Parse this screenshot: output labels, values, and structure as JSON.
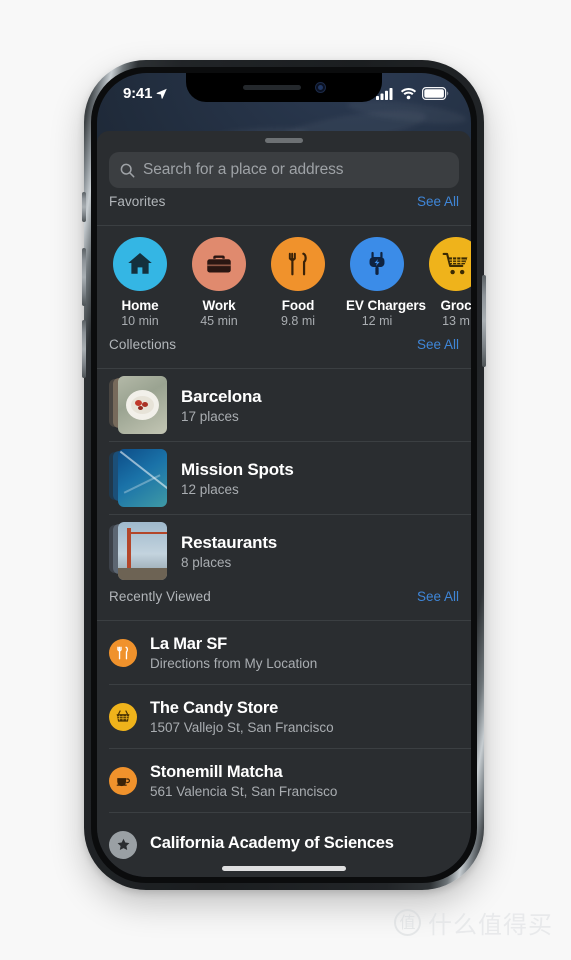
{
  "status_bar": {
    "time": "9:41",
    "location_arrow": "location-arrow-icon",
    "cellular": "signal-bars-icon",
    "wifi": "wifi-icon",
    "battery": "battery-icon"
  },
  "search": {
    "placeholder": "Search for a place or address",
    "icon": "search-icon"
  },
  "sections": {
    "favorites": {
      "title": "Favorites",
      "see_all": "See All"
    },
    "collections": {
      "title": "Collections",
      "see_all": "See All"
    },
    "recents": {
      "title": "Recently Viewed",
      "see_all": "See All"
    }
  },
  "favorites": [
    {
      "label": "Home",
      "sub": "10 min",
      "icon": "home-icon",
      "color": "#34b6e4",
      "glyph_color": "#14303d"
    },
    {
      "label": "Work",
      "sub": "45 min",
      "icon": "briefcase-icon",
      "color": "#e08a6e",
      "glyph_color": "#2a1612"
    },
    {
      "label": "Food",
      "sub": "9.8 mi",
      "icon": "fork-knife-icon",
      "color": "#f0922c",
      "glyph_color": "#3a2208"
    },
    {
      "label": "EV Chargers",
      "sub": "12 mi",
      "icon": "ev-plug-icon",
      "color": "#3b8ce8",
      "glyph_color": "#0f2340"
    },
    {
      "label": "Groc",
      "sub": "13 m",
      "icon": "shopping-cart-icon",
      "color": "#efb31b",
      "glyph_color": "#3a2a03"
    }
  ],
  "collections": [
    {
      "name": "Barcelona",
      "count": "17 places",
      "thumb": "food-plate-photo"
    },
    {
      "name": "Mission Spots",
      "count": "12 places",
      "thumb": "blue-abstract-photo"
    },
    {
      "name": "Restaurants",
      "count": "8 places",
      "thumb": "golden-gate-bridge-photo"
    }
  ],
  "recents": [
    {
      "name": "La Mar SF",
      "sub": "Directions from My Location",
      "icon": "fork-knife-icon",
      "color": "#f0922c",
      "glyph_color": "#ffffff"
    },
    {
      "name": "The Candy Store",
      "sub": "1507 Vallejo St, San Francisco",
      "icon": "basket-icon",
      "color": "#efb31b",
      "glyph_color": "#4a3304"
    },
    {
      "name": "Stonemill Matcha",
      "sub": "561 Valencia St, San Francisco",
      "icon": "coffee-cup-icon",
      "color": "#f0922c",
      "glyph_color": "#3a2208"
    },
    {
      "name": "California Academy of Sciences",
      "sub": "",
      "icon": "star-icon",
      "color": "#9aa0a4",
      "glyph_color": "#2a2d30"
    }
  ],
  "watermark": {
    "badge": "值",
    "text": "什么值得买"
  },
  "theme": {
    "accent_blue": "#3f86d8",
    "sheet_bg": "#2a2d30",
    "divider": "#3b3f42",
    "text_primary": "#ffffff",
    "text_secondary": "#a9adb1"
  }
}
